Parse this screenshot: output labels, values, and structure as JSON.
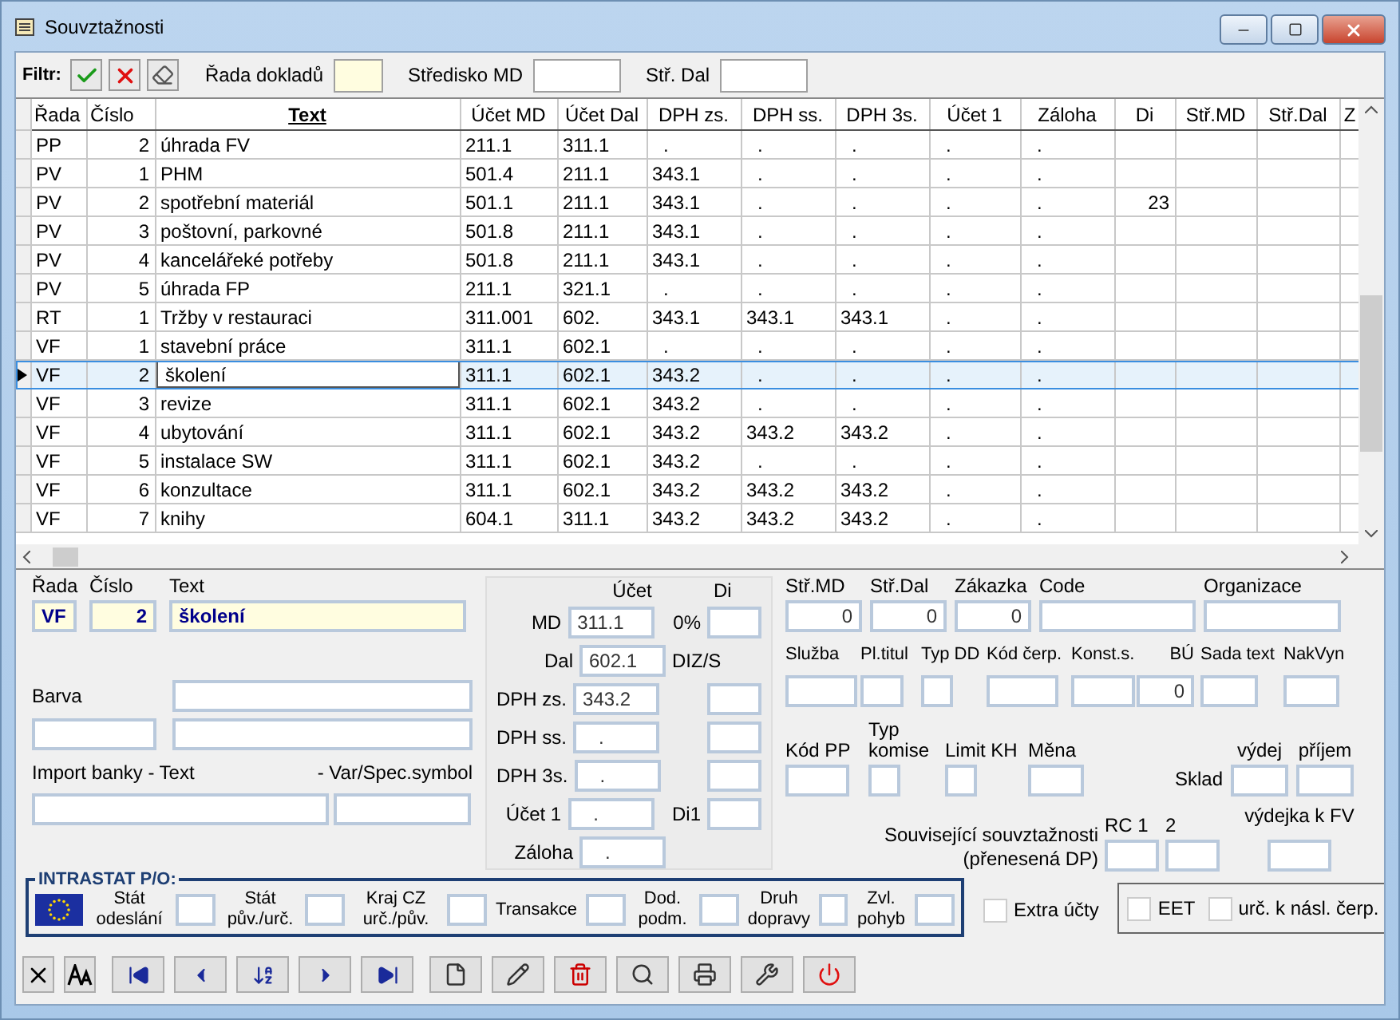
{
  "window": {
    "title": "Souvztažnosti"
  },
  "filter": {
    "label": "Filtr:",
    "fields": [
      {
        "label": "Řada dokladů",
        "highlighted": true
      },
      {
        "label": "Středisko MD",
        "highlighted": false
      },
      {
        "label": "Stř. Dal",
        "highlighted": false
      }
    ]
  },
  "table": {
    "columns": [
      {
        "label": "Řada",
        "sorted": false
      },
      {
        "label": "Číslo",
        "sorted": false
      },
      {
        "label": "Text",
        "sorted": true
      },
      {
        "label": "Účet MD",
        "sorted": false
      },
      {
        "label": "Účet Dal",
        "sorted": false
      },
      {
        "label": "DPH zs.",
        "sorted": false
      },
      {
        "label": "DPH ss.",
        "sorted": false
      },
      {
        "label": "DPH 3s.",
        "sorted": false
      },
      {
        "label": "Účet 1",
        "sorted": false
      },
      {
        "label": "Záloha",
        "sorted": false
      },
      {
        "label": "Di",
        "sorted": false
      },
      {
        "label": "Stř.MD",
        "sorted": false
      },
      {
        "label": "Stř.Dal",
        "sorted": false
      },
      {
        "label": "Z",
        "sorted": false
      }
    ],
    "rows": [
      {
        "selected": false,
        "cells": [
          "PP",
          "2",
          "úhrada FV",
          "211.1",
          "311.1",
          ".",
          ".",
          ".",
          ".",
          "."
        ]
      },
      {
        "selected": false,
        "cells": [
          "PV",
          "1",
          "PHM",
          "501.4",
          "211.1",
          "343.1",
          ".",
          ".",
          ".",
          "."
        ]
      },
      {
        "selected": false,
        "cells": [
          "PV",
          "2",
          "spotřební materiál",
          "501.1",
          "211.1",
          "343.1",
          ".",
          ".",
          ".",
          "."
        ],
        "di": "23"
      },
      {
        "selected": false,
        "cells": [
          "PV",
          "3",
          "poštovní, parkovné",
          "501.8",
          "211.1",
          "343.1",
          ".",
          ".",
          ".",
          "."
        ]
      },
      {
        "selected": false,
        "cells": [
          "PV",
          "4",
          "kancelářeké potřeby",
          "501.8",
          "211.1",
          "343.1",
          ".",
          ".",
          ".",
          "."
        ]
      },
      {
        "selected": false,
        "cells": [
          "PV",
          "5",
          "úhrada FP",
          "211.1",
          "321.1",
          ".",
          ".",
          ".",
          ".",
          "."
        ]
      },
      {
        "selected": false,
        "cells": [
          "RT",
          "1",
          "Tržby v restauraci",
          "311.001",
          "602.",
          "343.1",
          "343.1",
          "343.1",
          ".",
          "."
        ]
      },
      {
        "selected": false,
        "cells": [
          "VF",
          "1",
          "stavební práce",
          "311.1",
          "602.1",
          ".",
          ".",
          ".",
          ".",
          "."
        ]
      },
      {
        "selected": true,
        "cells": [
          "VF",
          "2",
          "školení",
          "311.1",
          "602.1",
          "343.2",
          ".",
          ".",
          ".",
          "."
        ]
      },
      {
        "selected": false,
        "cells": [
          "VF",
          "3",
          "revize",
          "311.1",
          "602.1",
          "343.2",
          ".",
          ".",
          ".",
          "."
        ]
      },
      {
        "selected": false,
        "cells": [
          "VF",
          "4",
          "ubytování",
          "311.1",
          "602.1",
          "343.2",
          "343.2",
          "343.2",
          ".",
          "."
        ]
      },
      {
        "selected": false,
        "cells": [
          "VF",
          "5",
          "instalace SW",
          "311.1",
          "602.1",
          "343.2",
          ".",
          ".",
          ".",
          "."
        ]
      },
      {
        "selected": false,
        "cells": [
          "VF",
          "6",
          "konzultace",
          "311.1",
          "602.1",
          "343.2",
          "343.2",
          "343.2",
          ".",
          "."
        ]
      },
      {
        "selected": false,
        "cells": [
          "VF",
          "7",
          "knihy",
          "604.1",
          "311.1",
          "343.2",
          "343.2",
          "343.2",
          ".",
          "."
        ]
      }
    ]
  },
  "detail": {
    "head": [
      {
        "label": "Řada",
        "value": "VF"
      },
      {
        "label": "Číslo",
        "value": "2"
      },
      {
        "label": "Text",
        "value": "školení"
      }
    ],
    "barva_label": "Barva",
    "import_label": "Import banky - Text",
    "symbol_label": "- Var/Spec.symbol",
    "accounts": {
      "title": "Účet",
      "di_title": "Di",
      "rows": [
        {
          "label": "MD",
          "value": "311.1",
          "di_label": "0%",
          "di_field": true
        },
        {
          "label": "Dal",
          "value": "602.1",
          "di_label": "DIZ/S",
          "di_field": false
        },
        {
          "label": "DPH zs.",
          "value": "343.2",
          "di_field": true
        },
        {
          "label": "DPH ss.",
          "value": ".",
          "di_field": true
        },
        {
          "label": "DPH 3s.",
          "value": ".",
          "di_field": true
        },
        {
          "label": "Účet 1",
          "value": ".",
          "di_label": "Di1",
          "di_field": true
        },
        {
          "label": "Záloha",
          "value": ".",
          "di_field": false
        }
      ]
    },
    "row1": [
      {
        "label": "Stř.MD",
        "value": "0"
      },
      {
        "label": "Stř.Dal",
        "value": "0"
      },
      {
        "label": "Zákazka",
        "value": "0"
      },
      {
        "label": "Code"
      },
      {
        "label": "Organizace"
      }
    ],
    "row2": [
      {
        "label": "Služba"
      },
      {
        "label": "Pl.titul"
      },
      {
        "label": "Typ DD"
      },
      {
        "label": "Kód čerp."
      },
      {
        "label": "Konst.s."
      },
      {
        "label": "BÚ",
        "value": "0"
      },
      {
        "label": "Sada text"
      },
      {
        "label": "NakVyn"
      }
    ],
    "row3": [
      {
        "label": "Kód PP"
      },
      {
        "label": "Typ komise"
      },
      {
        "label": "Limit KH"
      },
      {
        "label": "Měna"
      }
    ],
    "sklad": {
      "label": "Sklad",
      "fields": [
        {
          "label": "výdej"
        },
        {
          "label": "příjem"
        }
      ]
    },
    "related": {
      "label": "Související souvztažnosti (přenesená DP)",
      "fields": [
        {
          "label": "RC 1"
        },
        {
          "label": "2"
        },
        {
          "label": "výdejka k FV"
        }
      ]
    }
  },
  "intrastat": {
    "title": "INTRASTAT P/O:",
    "fields": [
      {
        "label": "Stát odeslání"
      },
      {
        "label": "Stát pův./urč."
      },
      {
        "label": "Kraj CZ urč./pův."
      },
      {
        "label": "Transakce"
      },
      {
        "label": "Dod. podm."
      },
      {
        "label": "Druh dopravy"
      },
      {
        "label": "Zvl. pohyb"
      }
    ]
  },
  "checkboxes": [
    {
      "label": "Extra účty",
      "checked": false
    },
    {
      "label": "EET",
      "checked": false
    },
    {
      "label": "urč. k násl. čerp.",
      "checked": false
    }
  ]
}
